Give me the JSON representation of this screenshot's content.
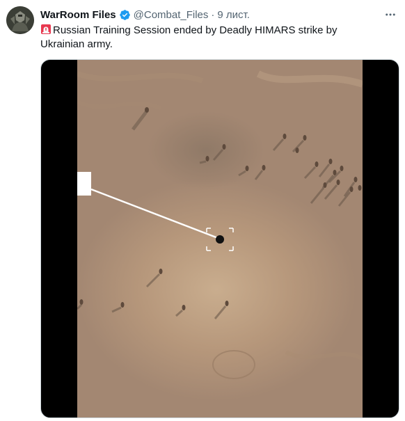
{
  "tweet": {
    "author": {
      "display_name": "WarRoom Files",
      "handle": "@Combat_Files",
      "verified_icon": "verified-badge-icon"
    },
    "separator": "·",
    "timestamp": "9 лист.",
    "more_icon": "more-options-icon",
    "text_icon": "siren-emoji-icon",
    "text": "Russian Training Session ended by Deadly HIMARS strike by Ukrainian army."
  },
  "colors": {
    "accent": "#1d9bf0",
    "secondary_text": "#536471",
    "primary_text": "#0f1419",
    "ground": "#b99c80",
    "media_letterbox": "#000000"
  }
}
